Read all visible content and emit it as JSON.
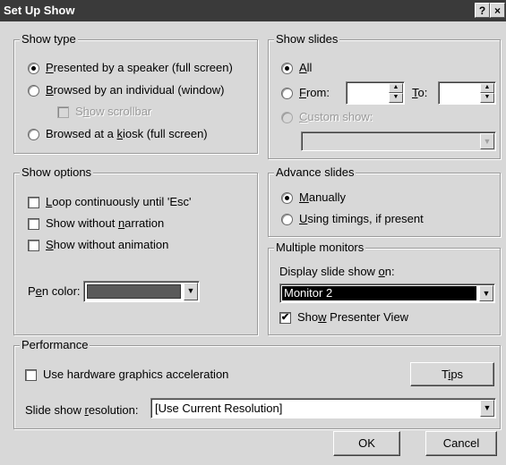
{
  "title": "Set Up Show",
  "titlebar": {
    "help": "?",
    "close": "×"
  },
  "show_type": {
    "legend": "Show type",
    "speaker": {
      "key": "P",
      "rest": "resented by a speaker (full screen)"
    },
    "individual": {
      "key": "B",
      "rest": "rowsed by an individual (window)"
    },
    "scrollbar": {
      "pre": "S",
      "key": "h",
      "rest": "ow scrollbar"
    },
    "kiosk": {
      "pre": "Browsed at a ",
      "key": "k",
      "rest": "iosk (full screen)"
    }
  },
  "show_slides": {
    "legend": "Show slides",
    "all": {
      "key": "A",
      "rest": "ll"
    },
    "from": {
      "key": "F",
      "rest": "rom:"
    },
    "to": {
      "key": "T",
      "rest": "o:"
    },
    "custom": {
      "key": "C",
      "rest": "ustom show:"
    },
    "from_value": "",
    "to_value": ""
  },
  "show_options": {
    "legend": "Show options",
    "loop": {
      "key": "L",
      "rest": "oop continuously until 'Esc'"
    },
    "narration": {
      "pre": "Show without ",
      "key": "n",
      "rest": "arration"
    },
    "animation": {
      "key": "S",
      "rest": "how without animation"
    },
    "pen": {
      "pre": "P",
      "key": "e",
      "rest": "n color:"
    },
    "pen_color": "#5a5a5a"
  },
  "advance": {
    "legend": "Advance slides",
    "manually": {
      "key": "M",
      "rest": "anually"
    },
    "timings": {
      "key": "U",
      "rest": "sing timings, if present"
    }
  },
  "monitors": {
    "legend": "Multiple monitors",
    "display_label": {
      "pre": "Display slide show ",
      "key": "o",
      "rest": "n:"
    },
    "monitor_value": "Monitor 2",
    "presenter": {
      "pre": "Sho",
      "key": "w",
      "rest": " Presenter View"
    }
  },
  "performance": {
    "legend": "Performance",
    "hardware": {
      "pre": "Use hardware ",
      "key": "g",
      "rest": "raphics acceleration"
    },
    "tips": {
      "pre": "T",
      "key": "i",
      "rest": "ps"
    },
    "resolution_label": {
      "pre": "Slide show ",
      "key": "r",
      "rest": "esolution:"
    },
    "resolution_value": "[Use Current Resolution]"
  },
  "buttons": {
    "ok": "OK",
    "cancel": "Cancel"
  },
  "glyphs": {
    "check": "✔",
    "down": "▼",
    "up": "▲"
  }
}
